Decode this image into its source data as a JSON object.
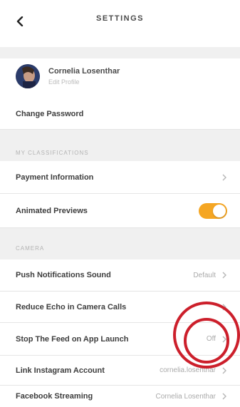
{
  "header": {
    "title": "SETTINGS",
    "back_icon": "chevron-left-icon"
  },
  "profile": {
    "name": "Cornelia Losenthar",
    "subtitle": "Edit Profile"
  },
  "rows": {
    "change_password": "Change Password",
    "section_account": "MY CLASSIFICATIONS",
    "payment_information": "Payment Information",
    "animated_previews": "Animated Previews",
    "section_camera": "CAMERA",
    "push_sound": {
      "label": "Push Notifications Sound",
      "value": "Default"
    },
    "reduce_echo": {
      "label": "Reduce Echo in Camera Calls",
      "value": ""
    },
    "stop_feed": {
      "label": "Stop The Feed on App Launch",
      "value": "Off"
    },
    "link_instagram": {
      "label": "Link Instagram Account",
      "value": "cornelia.losenthar"
    },
    "facebook_streaming": {
      "label": "Facebook Streaming",
      "value": "Cornelia Losenthar"
    }
  },
  "toggles": {
    "animated_previews_on": true,
    "accent_color": "#f5a623"
  },
  "annotation": {
    "ring_color": "#cc1f2b"
  }
}
